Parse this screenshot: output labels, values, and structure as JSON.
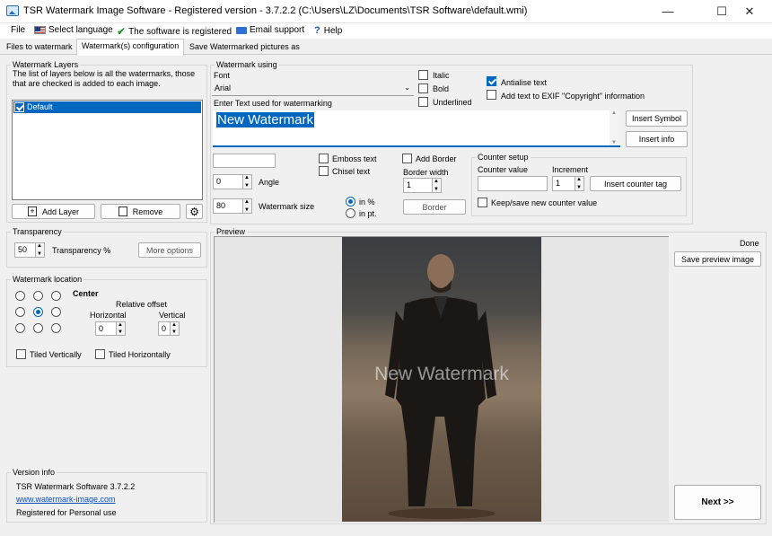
{
  "window": {
    "title": "TSR Watermark Image Software - Registered version - 3.7.2.2 (C:\\Users\\LZ\\Documents\\TSR Software\\default.wmi)",
    "minimize": "—",
    "maximize": "☐",
    "close": "✕"
  },
  "menu": {
    "file": "File",
    "language": "Select language",
    "registered": "The software is registered",
    "email": "Email support",
    "help": "Help"
  },
  "tabs": [
    "Files to watermark",
    "Watermark(s) configuration",
    "Save Watermarked pictures as"
  ],
  "layers": {
    "legend": "Watermark Layers",
    "description": "The list of layers below is all the watermarks, those that are checked is added to each image.",
    "items": [
      {
        "label": "Default",
        "checked": true
      }
    ],
    "add": "Add Layer",
    "remove": "Remove"
  },
  "transparency": {
    "legend": "Transparency",
    "value": "50",
    "label": "Transparency %",
    "more": "More options"
  },
  "location": {
    "legend": "Watermark location",
    "position": "Center",
    "offset_title": "Relative offset",
    "horizontal": "Horizontal",
    "vertical": "Vertical",
    "h_value": "0",
    "v_value": "0",
    "tiled_v": "Tiled Vertically",
    "tiled_h": "Tiled Horizontally"
  },
  "version": {
    "legend": "Version info",
    "name": "TSR Watermark Software 3.7.2.2",
    "url": "www.watermark-image.com",
    "license": "Registered for Personal use"
  },
  "watermark": {
    "legend": "Watermark using",
    "font_label": "Font",
    "font": "Arial",
    "italic": "Italic",
    "bold": "Bold",
    "underlined": "Underlined",
    "antialias": "Antialise text",
    "exif": "Add text to EXIF \"Copyright\" information",
    "text_label": "Enter Text used for watermarking",
    "text": "New Watermark",
    "insert_symbol": "Insert Symbol",
    "insert_info": "Insert info",
    "emboss": "Emboss text",
    "chisel": "Chisel text",
    "add_border": "Add Border",
    "border_width_label": "Border width",
    "border_width": "1",
    "border_btn": "Border",
    "angle_value": "0",
    "angle_label": "Angle",
    "size_value": "80",
    "size_label": "Watermark size",
    "in_percent": "in %",
    "in_pt": "in pt."
  },
  "counter": {
    "legend": "Counter setup",
    "value_label": "Counter value",
    "increment_label": "Increment",
    "increment": "1",
    "insert_tag": "Insert counter tag",
    "keep": "Keep/save new counter value"
  },
  "preview": {
    "legend": "Preview",
    "overlay": "New Watermark",
    "status": "Done",
    "save": "Save preview image",
    "next": "Next >>"
  },
  "colors": {
    "selection": "#0067c0",
    "link": "#0a4fc4"
  }
}
